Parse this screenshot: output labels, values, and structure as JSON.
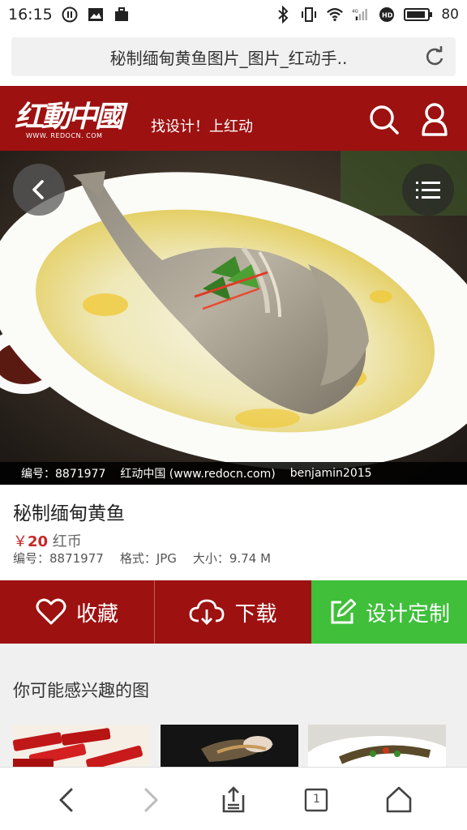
{
  "status": {
    "time": "16:15",
    "battery": "80",
    "network": "4G"
  },
  "browser": {
    "address_text": "秘制缅甸黄鱼图片_图片_红动手..",
    "tab_count": "1"
  },
  "header": {
    "logo_text": "红動中國",
    "logo_url": "WWW. REDOCN. COM",
    "slogan": "找设计！上红动"
  },
  "photo": {
    "watermark_id": "编号：8871977",
    "watermark_site": "红动中国 (www.redocn.com)",
    "watermark_author": "benjamin2015"
  },
  "product": {
    "title": "秘制缅甸黄鱼",
    "currency_symbol": "￥",
    "price": "20",
    "price_unit": "红币",
    "id_label": "编号：8871977",
    "format_label": "格式：JPG",
    "size_label": "大小：9.74 M"
  },
  "actions": {
    "favorite": "收藏",
    "download": "下载",
    "custom": "设计定制"
  },
  "related": {
    "title": "你可能感兴趣的图"
  },
  "colors": {
    "brand_red": "#9d1111",
    "accent_green": "#3fbf3a",
    "price_red": "#c62828"
  }
}
